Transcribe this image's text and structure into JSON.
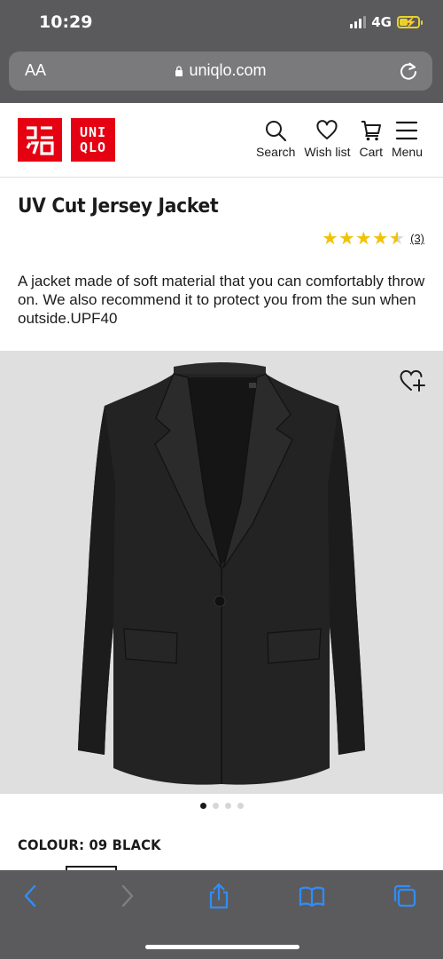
{
  "status_bar": {
    "time": "10:29",
    "network": "4G",
    "battery_level": 0.45
  },
  "browser": {
    "text_size_label": "AA",
    "url": "uniqlo.com",
    "icons": [
      "lock-icon",
      "reload-icon"
    ]
  },
  "header": {
    "logo_left": "ユニ\nクロ",
    "logo_right": "UNI\nQLO",
    "nav": [
      {
        "label": "Search",
        "icon": "search-icon"
      },
      {
        "label": "Wish list",
        "icon": "heart-icon"
      },
      {
        "label": "Cart",
        "icon": "cart-icon"
      },
      {
        "label": "Menu",
        "icon": "menu-icon"
      }
    ]
  },
  "product": {
    "title": "UV Cut Jersey Jacket",
    "rating": 4.5,
    "rating_stars": "★★★★★",
    "review_count": "(3)",
    "description": "A jacket made of soft material that you can comfortably throw on. We also recommend it to protect you from the sun when outside.UPF40",
    "image_count": 4,
    "active_image": 1,
    "colour_label": "COLOUR: 09 BLACK"
  },
  "toolbar": {
    "buttons": [
      "back-icon",
      "forward-icon",
      "share-icon",
      "bookmarks-icon",
      "tabs-icon"
    ]
  },
  "colors": {
    "brand_red": "#e50012",
    "star_gold": "#f2c300",
    "safari_blue": "#2f8dfc"
  }
}
